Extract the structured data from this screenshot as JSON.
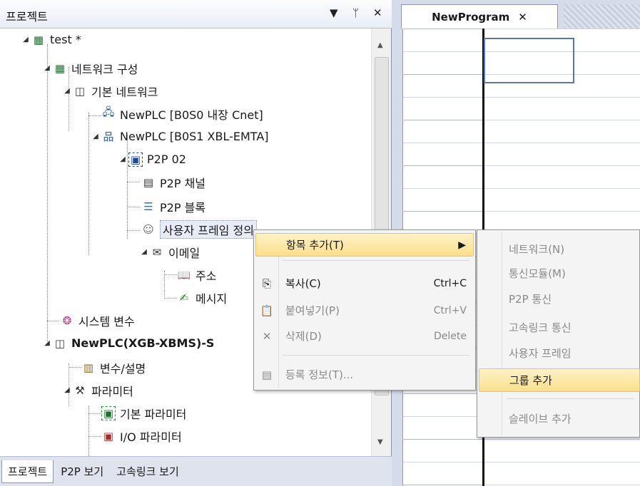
{
  "project_pane": {
    "title": "프로젝트",
    "buttons": {
      "dropdown": "▼",
      "pin": "ᛘ",
      "close": "✕"
    }
  },
  "tree": {
    "root": "test *",
    "network_config": "네트워크 구성",
    "basic_network": "기본 네트워크",
    "plc_cnet": "NewPLC [B0S0 내장 Cnet]",
    "plc_emta": "NewPLC [B0S1 XBL-EMTA]",
    "p2p": "P2P 02",
    "p2p_channel": "P2P 채널",
    "p2p_block": "P2P 블록",
    "user_frame": "사용자 프레임 정의",
    "email": "이메일",
    "address": "주소",
    "message": "메시지",
    "system_variable": "시스템 변수",
    "plc_main": "NewPLC(XGB-XBMS)-S",
    "var_desc": "변수/설명",
    "parameter": "파라미터",
    "basic_param": "기본 파라미터",
    "io_param": "I/O 파라미터"
  },
  "bottom_tabs": [
    "프로젝트",
    "P2P 보기",
    "고속링크 보기"
  ],
  "editor": {
    "tab_label": "NewProgram",
    "tab_close": "✕"
  },
  "context_menu": {
    "add_item": "항목 추가(T)",
    "copy": "복사(C)",
    "copy_shortcut": "Ctrl+C",
    "paste": "붙여넣기(P)",
    "paste_shortcut": "Ctrl+V",
    "delete": "삭제(D)",
    "delete_shortcut": "Delete",
    "register_info": "등록 정보(T)..."
  },
  "submenu": {
    "network": "네트워크(N)",
    "comm_module": "통신모듈(M)",
    "p2p_comm": "P2P 통신",
    "highspeed_link": "고속링크 통신",
    "user_frame": "사용자 프레임",
    "add_group": "그룹 추가",
    "add_slave": "슬레이브 추가"
  }
}
